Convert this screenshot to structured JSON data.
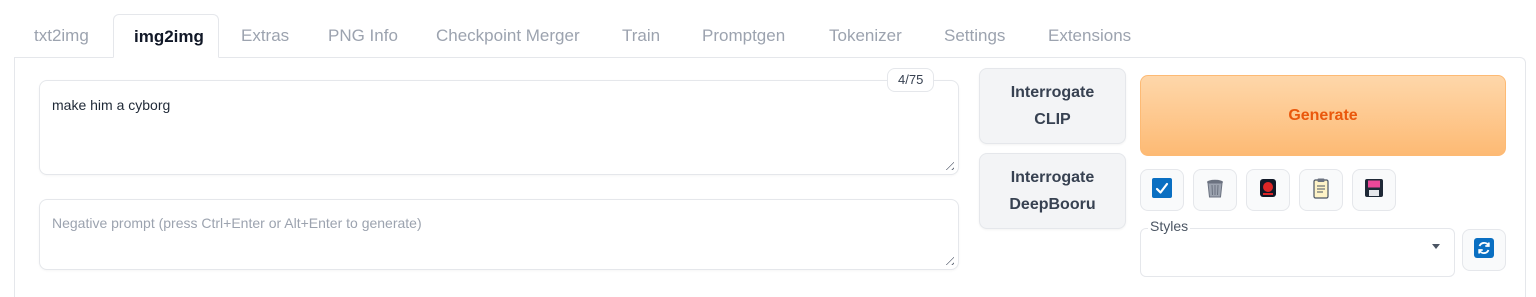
{
  "tabs": [
    {
      "label": "txt2img",
      "active": false
    },
    {
      "label": "img2img",
      "active": true
    },
    {
      "label": "Extras",
      "active": false
    },
    {
      "label": "PNG Info",
      "active": false
    },
    {
      "label": "Checkpoint Merger",
      "active": false
    },
    {
      "label": "Train",
      "active": false
    },
    {
      "label": "Promptgen",
      "active": false
    },
    {
      "label": "Tokenizer",
      "active": false
    },
    {
      "label": "Settings",
      "active": false
    },
    {
      "label": "Extensions",
      "active": false
    }
  ],
  "prompt": {
    "value": "make him a cyborg",
    "token_count": "4/75"
  },
  "negative_prompt": {
    "value": "",
    "placeholder": "Negative prompt (press Ctrl+Enter or Alt+Enter to generate)"
  },
  "interrogate": {
    "clip_line1": "Interrogate",
    "clip_line2": "CLIP",
    "deepbooru_line1": "Interrogate",
    "deepbooru_line2": "DeepBooru"
  },
  "generate": {
    "label": "Generate"
  },
  "tools": [
    {
      "icon": "check-icon"
    },
    {
      "icon": "trash-icon"
    },
    {
      "icon": "red-record-icon"
    },
    {
      "icon": "clipboard-icon"
    },
    {
      "icon": "floppy-disk-icon"
    }
  ],
  "styles": {
    "label": "Styles",
    "selected": "",
    "refresh_icon": "refresh-icon"
  },
  "colors": {
    "generate_bg": "#fdba74",
    "generate_text": "#ea580c",
    "accent_blue": "#0a6fc2"
  }
}
